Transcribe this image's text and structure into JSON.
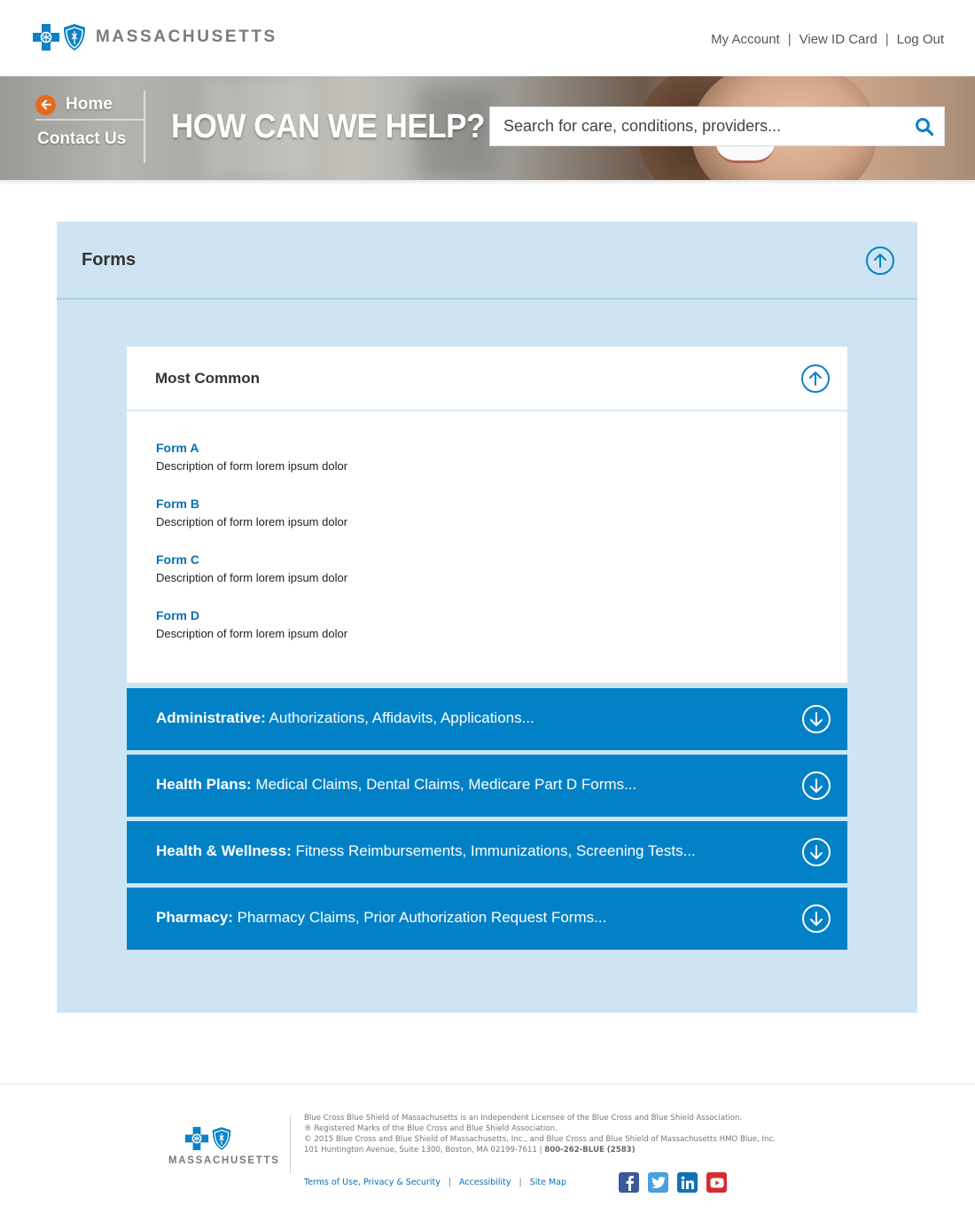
{
  "brand": {
    "wordmark": "MASSACHUSETTS",
    "blue": "#0b82c6",
    "orange": "#e56a1c"
  },
  "topnav": {
    "my_account": "My Account",
    "view_id_card": "View ID Card",
    "log_out": "Log Out",
    "separator": "|"
  },
  "hero": {
    "home": "Home",
    "contact": "Contact Us",
    "title": "HOW CAN WE HELP?",
    "search_placeholder": "Search for care, conditions, providers..."
  },
  "forms": {
    "title": "Forms",
    "most_common": {
      "title": "Most Common",
      "items": [
        {
          "name": "Form A",
          "desc": "Description of form lorem ipsum dolor"
        },
        {
          "name": "Form B",
          "desc": "Description of form lorem ipsum dolor"
        },
        {
          "name": "Form C",
          "desc": "Description of form lorem ipsum dolor"
        },
        {
          "name": "Form D",
          "desc": "Description of form lorem ipsum dolor"
        }
      ]
    },
    "categories": [
      {
        "label": "Administrative:",
        "rest": " Authorizations, Affidavits, Applications..."
      },
      {
        "label": "Health Plans:",
        "rest": " Medical Claims, Dental Claims, Medicare Part D Forms..."
      },
      {
        "label": "Health & Wellness:",
        "rest": " Fitness Reimbursements, Immunizations, Screening Tests..."
      },
      {
        "label": "Pharmacy:",
        "rest": " Pharmacy Claims, Prior Authorization Request Forms..."
      }
    ]
  },
  "footer": {
    "wordmark": "MASSACHUSETTS",
    "line1": "Blue Cross Blue Shield of Massachusetts is an Independent Licensee of the Blue Cross and Blue Shield Association.",
    "line2": "® Registered Marks of the Blue Cross and Blue Shield Association.",
    "line3": "© 2015 Blue Cross and Blue Shield of Massachusetts, Inc., and Blue Cross and Blue Shield of Massachusetts HMO Blue, Inc.",
    "line4": "101 Huntington Avenue, Suite 1300, Boston, MA 02199-7611 | ",
    "phone": "800-262-BLUE (2583)",
    "links": {
      "terms": "Terms of Use, Privacy & Security",
      "accessibility": "Accessibility",
      "sitemap": "Site Map",
      "separator": "|"
    },
    "social": [
      {
        "icon": "facebook-icon",
        "glyph": "f",
        "color": "#3b5998"
      },
      {
        "icon": "twitter-icon",
        "glyph": "t",
        "color": "#4a9fe0"
      },
      {
        "icon": "linkedin-icon",
        "glyph": "in",
        "color": "#1173b4"
      },
      {
        "icon": "youtube-icon",
        "glyph": "▶",
        "color": "#d72b30"
      }
    ]
  }
}
